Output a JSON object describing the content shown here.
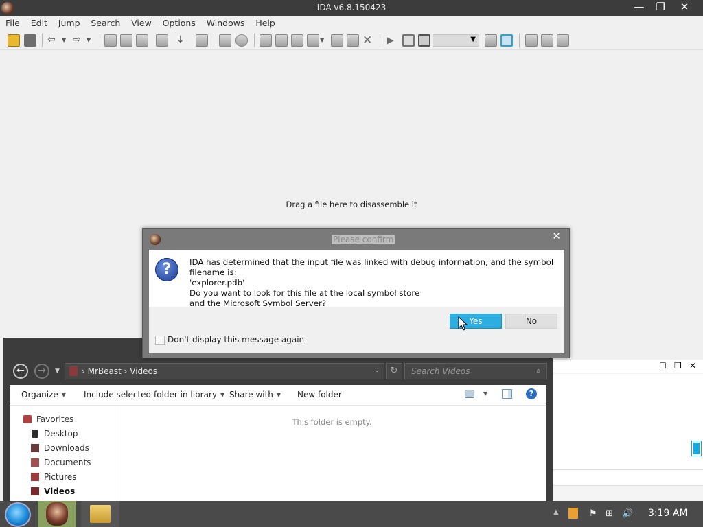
{
  "ida": {
    "title": "IDA v6.8.150423",
    "menu": [
      "File",
      "Edit",
      "Jump",
      "Search",
      "View",
      "Options",
      "Windows",
      "Help"
    ],
    "drop_hint": "Drag a file here to disassemble it",
    "window_controls": {
      "minimize": "—",
      "maximize": "❐",
      "close": "✕"
    }
  },
  "dialog": {
    "title": "Please confirm",
    "message_lines": [
      "IDA has determined that the input file was linked with debug information, and the symbol filename is:",
      "'explorer.pdb'",
      "Do you want to look for this file at the local symbol store",
      "and the Microsoft Symbol Server?"
    ],
    "yes_label": "Yes",
    "no_label": "No",
    "checkbox_label": "Don't display this message again",
    "checkbox_checked": false,
    "close_glyph": "✕",
    "icon_glyph": "?"
  },
  "explorer": {
    "breadcrumb": [
      "MrBeast",
      "Videos"
    ],
    "breadcrumb_text": "›  MrBeast  ›  Videos",
    "search_placeholder": "Search Videos",
    "commands": {
      "organize": "Organize",
      "include": "Include selected folder in library",
      "share": "Share with",
      "new_folder": "New folder"
    },
    "nav_items": [
      {
        "label": "Favorites",
        "color": "#b04040"
      },
      {
        "label": "Desktop",
        "color": "#303030"
      },
      {
        "label": "Downloads",
        "color": "#6a3a3a"
      },
      {
        "label": "Documents",
        "color": "#a05050"
      },
      {
        "label": "Pictures",
        "color": "#a03a3a"
      },
      {
        "label": "Videos",
        "color": "#7a2a2a"
      }
    ],
    "empty_text": "This folder is empty."
  },
  "taskbar": {
    "time": "3:19 AM"
  },
  "colors": {
    "accent": "#2eaee0",
    "titlebar": "#3c3c3c",
    "taskbar": "#4a4a4a"
  }
}
